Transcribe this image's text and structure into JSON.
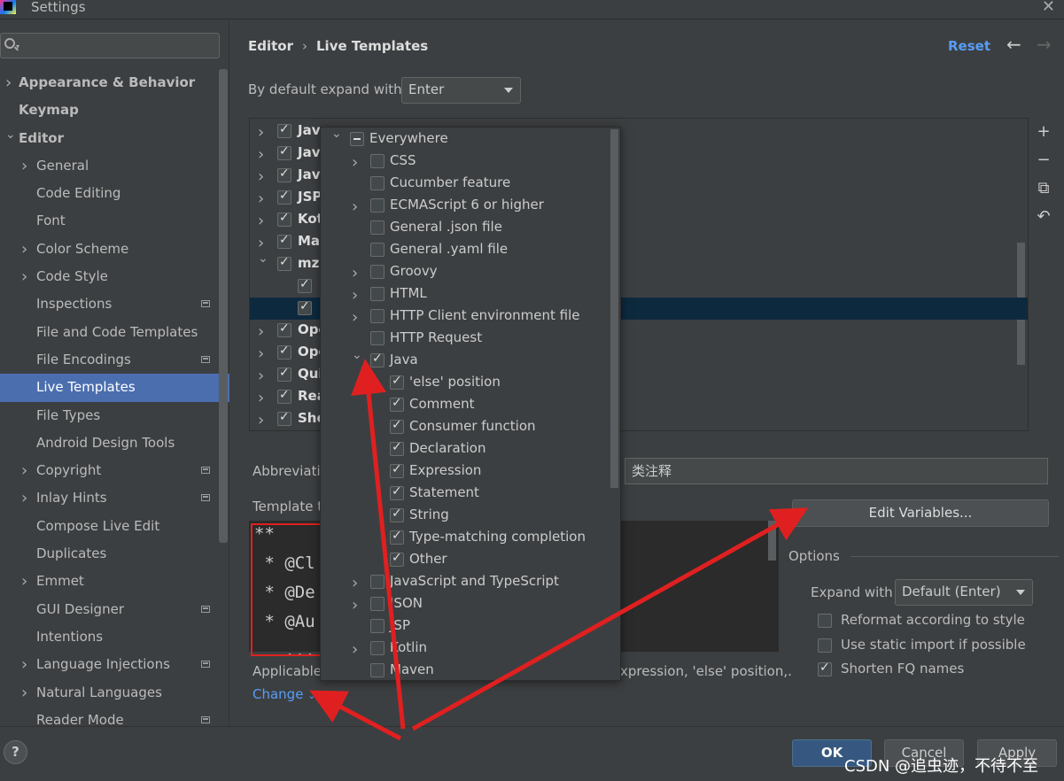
{
  "window": {
    "title": "Settings"
  },
  "sidebar": {
    "items": [
      {
        "label": "Appearance & Behavior",
        "level": 0,
        "chevron": true,
        "bold": true
      },
      {
        "label": "Keymap",
        "level": 0,
        "chevron": false,
        "bold": true
      },
      {
        "label": "Editor",
        "level": 0,
        "chevron": true,
        "expanded": true,
        "bold": true
      },
      {
        "label": "General",
        "level": 1,
        "chevron": true
      },
      {
        "label": "Code Editing",
        "level": 1
      },
      {
        "label": "Font",
        "level": 1
      },
      {
        "label": "Color Scheme",
        "level": 1,
        "chevron": true
      },
      {
        "label": "Code Style",
        "level": 1,
        "chevron": true
      },
      {
        "label": "Inspections",
        "level": 1,
        "badge": true
      },
      {
        "label": "File and Code Templates",
        "level": 1
      },
      {
        "label": "File Encodings",
        "level": 1,
        "badge": true
      },
      {
        "label": "Live Templates",
        "level": 1,
        "selected": true
      },
      {
        "label": "File Types",
        "level": 1
      },
      {
        "label": "Android Design Tools",
        "level": 1
      },
      {
        "label": "Copyright",
        "level": 1,
        "chevron": true,
        "badge": true
      },
      {
        "label": "Inlay Hints",
        "level": 1,
        "chevron": true,
        "badge": true
      },
      {
        "label": "Compose Live Edit",
        "level": 1
      },
      {
        "label": "Duplicates",
        "level": 1
      },
      {
        "label": "Emmet",
        "level": 1,
        "chevron": true
      },
      {
        "label": "GUI Designer",
        "level": 1,
        "badge": true
      },
      {
        "label": "Intentions",
        "level": 1
      },
      {
        "label": "Language Injections",
        "level": 1,
        "chevron": true,
        "badge": true
      },
      {
        "label": "Natural Languages",
        "level": 1,
        "chevron": true
      },
      {
        "label": "Reader Mode",
        "level": 1,
        "badge": true
      }
    ]
  },
  "breadcrumb": {
    "section": "Editor",
    "page": "Live Templates",
    "separator": "›"
  },
  "header": {
    "reset_label": "Reset",
    "back_icon": "←",
    "forward_icon": "→"
  },
  "expand": {
    "label": "By default expand with",
    "value": "Enter"
  },
  "template_groups": [
    {
      "name": "Jav",
      "checked": true,
      "expandable": true
    },
    {
      "name": "Jav",
      "checked": true,
      "expandable": true
    },
    {
      "name": "Jav",
      "checked": true,
      "expandable": true
    },
    {
      "name": "JSP",
      "checked": true,
      "expandable": true
    },
    {
      "name": "Kot",
      "checked": true,
      "expandable": true
    },
    {
      "name": "Ma",
      "checked": true,
      "expandable": true
    },
    {
      "name": "mz",
      "checked": true,
      "expandable": true,
      "expanded": true
    },
    {
      "name": "",
      "checked": true,
      "child": true
    },
    {
      "name": "",
      "checked": true,
      "child": true,
      "highlighted": true
    },
    {
      "name": "Ope",
      "checked": true,
      "expandable": true
    },
    {
      "name": "Ope",
      "checked": true,
      "expandable": true
    },
    {
      "name": "Qui",
      "checked": true,
      "expandable": true
    },
    {
      "name": "Rea",
      "checked": true,
      "expandable": true
    },
    {
      "name": "She",
      "checked": true,
      "expandable": true
    }
  ],
  "side_tools": [
    "+",
    "−",
    "⧉",
    "↶"
  ],
  "abbreviation": {
    "label": "Abbreviati"
  },
  "description": {
    "value": "类注释"
  },
  "template_text": {
    "label": "Template t",
    "lines": [
      "**",
      " * @Cl",
      " * @De",
      " * @Au",
      "   ..."
    ]
  },
  "edit_variables_label": "Edit Variables...",
  "options": {
    "title": "Options",
    "expand_with_label": "Expand with",
    "expand_with_value": "Default (Enter)",
    "checkboxes": [
      {
        "label": "Reformat according to style",
        "checked": false
      },
      {
        "label": "Use static import if possible",
        "checked": false
      },
      {
        "label": "Shorten FQ names",
        "checked": true
      }
    ]
  },
  "applicable": {
    "label": "Applicable",
    "tail": "xpression, 'else' position,."
  },
  "change_label": "Change",
  "context_popup": {
    "items": [
      {
        "label": "Everywhere",
        "level": 0,
        "chevron": "down",
        "state": "indeterminate"
      },
      {
        "label": "CSS",
        "level": 1,
        "chevron": "right",
        "state": "off"
      },
      {
        "label": "Cucumber feature",
        "level": 1,
        "state": "off"
      },
      {
        "label": "ECMAScript 6 or higher",
        "level": 1,
        "chevron": "right",
        "state": "off"
      },
      {
        "label": "General .json file",
        "level": 1,
        "state": "off"
      },
      {
        "label": "General .yaml file",
        "level": 1,
        "state": "off"
      },
      {
        "label": "Groovy",
        "level": 1,
        "chevron": "right",
        "state": "off"
      },
      {
        "label": "HTML",
        "level": 1,
        "chevron": "right",
        "state": "off"
      },
      {
        "label": "HTTP Client environment file",
        "level": 1,
        "chevron": "right",
        "state": "off"
      },
      {
        "label": "HTTP Request",
        "level": 1,
        "state": "off"
      },
      {
        "label": "Java",
        "level": 1,
        "chevron": "down",
        "state": "on"
      },
      {
        "label": "'else' position",
        "level": 2,
        "state": "on"
      },
      {
        "label": "Comment",
        "level": 2,
        "state": "on"
      },
      {
        "label": "Consumer function",
        "level": 2,
        "state": "on"
      },
      {
        "label": "Declaration",
        "level": 2,
        "state": "on"
      },
      {
        "label": "Expression",
        "level": 2,
        "state": "on"
      },
      {
        "label": "Statement",
        "level": 2,
        "state": "on"
      },
      {
        "label": "String",
        "level": 2,
        "state": "on"
      },
      {
        "label": "Type-matching completion",
        "level": 2,
        "state": "on"
      },
      {
        "label": "Other",
        "level": 2,
        "state": "on"
      },
      {
        "label": "JavaScript and TypeScript",
        "level": 1,
        "chevron": "right",
        "state": "off"
      },
      {
        "label": "JSON",
        "level": 1,
        "chevron": "right",
        "state": "off"
      },
      {
        "label": "JSP",
        "level": 1,
        "state": "off"
      },
      {
        "label": "Kotlin",
        "level": 1,
        "chevron": "right",
        "state": "off"
      },
      {
        "label": "Maven",
        "level": 1,
        "state": "off"
      }
    ]
  },
  "buttons": {
    "ok": "OK",
    "cancel": "Cancel",
    "apply": "Apply",
    "help": "?"
  },
  "watermark": "CSDN @追虫迹，不待不至",
  "colors": {
    "accent": "#4b6eaf",
    "link": "#589df6",
    "annotation": "#e02020"
  }
}
